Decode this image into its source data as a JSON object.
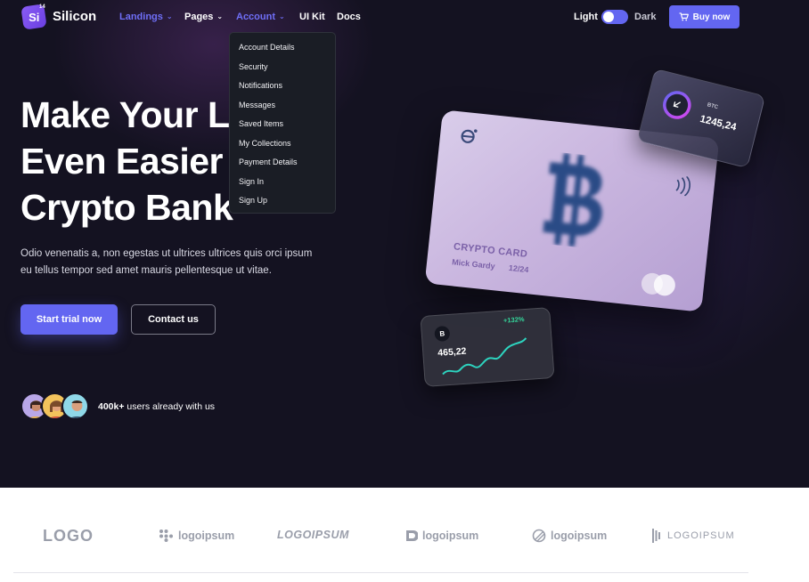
{
  "brand": {
    "name": "Silicon",
    "badge": "Si",
    "badge_sup": "14"
  },
  "nav": {
    "links": [
      {
        "label": "Landings",
        "active": true,
        "has_caret": true
      },
      {
        "label": "Pages",
        "active": false,
        "has_caret": true
      },
      {
        "label": "Account",
        "active": true,
        "has_caret": true
      },
      {
        "label": "UI Kit",
        "active": false,
        "has_caret": false
      },
      {
        "label": "Docs",
        "active": false,
        "has_caret": false
      }
    ],
    "theme_light": "Light",
    "theme_dark": "Dark",
    "buy_label": "Buy now"
  },
  "account_menu": {
    "items": [
      "Account Details",
      "Security",
      "Notifications",
      "Messages",
      "Saved Items",
      "My Collections",
      "Payment Details",
      "Sign In",
      "Sign Up"
    ]
  },
  "hero": {
    "headline_lines": [
      "Make Your Li",
      "Even Easier",
      "Crypto Bank"
    ],
    "headline_partial_char": "v",
    "lead": "Odio venenatis a, non egestas ut ultrices ultrices quis orci ipsum eu tellus tempor sed amet mauris pellentesque ut vitae.",
    "primary_cta": "Start trial now",
    "secondary_cta": "Contact us",
    "users_count": "400k+",
    "users_text": " users already with us"
  },
  "card": {
    "title": "CRYPTO CARD",
    "holder": "Mick Gardy",
    "expiry": "12/24",
    "btc_label": "BTC",
    "btc_value": "1245,24",
    "chart_badge": "B",
    "chart_change": "+132%",
    "chart_value": "465,22"
  },
  "logos": [
    "LOGO",
    "logoipsum",
    "LOGOIPSUM",
    "logoipsum",
    "logoipsum",
    "LOGOIPSUM"
  ],
  "colors": {
    "accent": "#6366f1",
    "hero_bg": "#141221",
    "logo_gray": "#9a9eaa"
  }
}
